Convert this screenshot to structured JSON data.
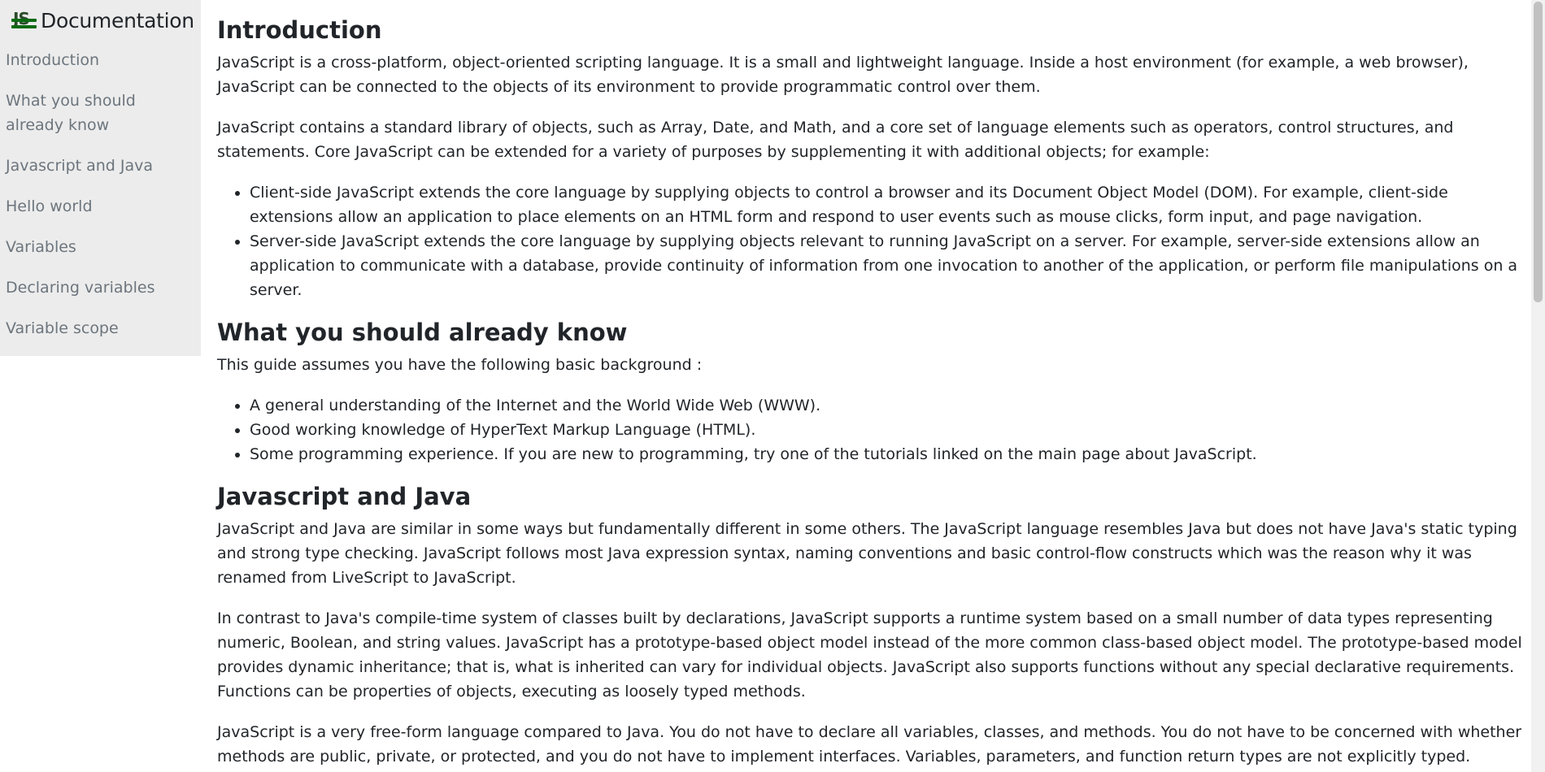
{
  "sidebar": {
    "logo_text": "JS",
    "title": "Documentation",
    "links": [
      "Introduction",
      "What you should already know",
      "Javascript and Java",
      "Hello world",
      "Variables",
      "Declaring variables",
      "Variable scope"
    ]
  },
  "main": {
    "introduction": {
      "heading": "Introduction",
      "p1": "JavaScript is a cross-platform, object-oriented scripting language. It is a small and lightweight language. Inside a host environment (for example, a web browser), JavaScript can be connected to the objects of its environment to provide programmatic control over them.",
      "p2": "JavaScript contains a standard library of objects, such as Array, Date, and Math, and a core set of language elements such as operators, control structures, and statements. Core JavaScript can be extended for a variety of purposes by supplementing it with additional objects; for example:",
      "items": [
        "Client-side JavaScript extends the core language by supplying objects to control a browser and its Document Object Model (DOM). For example, client-side extensions allow an application to place elements on an HTML form and respond to user events such as mouse clicks, form input, and page navigation.",
        "Server-side JavaScript extends the core language by supplying objects relevant to running JavaScript on a server. For example, server-side extensions allow an application to communicate with a database, provide continuity of information from one invocation to another of the application, or perform file manipulations on a server."
      ]
    },
    "know": {
      "heading": "What you should already know",
      "p1": "This guide assumes you have the following basic background :",
      "items": [
        "A general understanding of the Internet and the World Wide Web (WWW).",
        "Good working knowledge of HyperText Markup Language (HTML).",
        "Some programming experience. If you are new to programming, try one of the tutorials linked on the main page about JavaScript."
      ]
    },
    "java": {
      "heading": "Javascript and Java",
      "p1": "JavaScript and Java are similar in some ways but fundamentally different in some others. The JavaScript language resembles Java but does not have Java's static typing and strong type checking. JavaScript follows most Java expression syntax, naming conventions and basic control-flow constructs which was the reason why it was renamed from LiveScript to JavaScript.",
      "p2": "In contrast to Java's compile-time system of classes built by declarations, JavaScript supports a runtime system based on a small number of data types representing numeric, Boolean, and string values. JavaScript has a prototype-based object model instead of the more common class-based object model. The prototype-based model provides dynamic inheritance; that is, what is inherited can vary for individual objects. JavaScript also supports functions without any special declarative requirements. Functions can be properties of objects, executing as loosely typed methods.",
      "p3": "JavaScript is a very free-form language compared to Java. You do not have to declare all variables, classes, and methods. You do not have to be concerned with whether methods are public, private, or protected, and you do not have to implement interfaces. Variables, parameters, and function return types are not explicitly typed."
    }
  }
}
